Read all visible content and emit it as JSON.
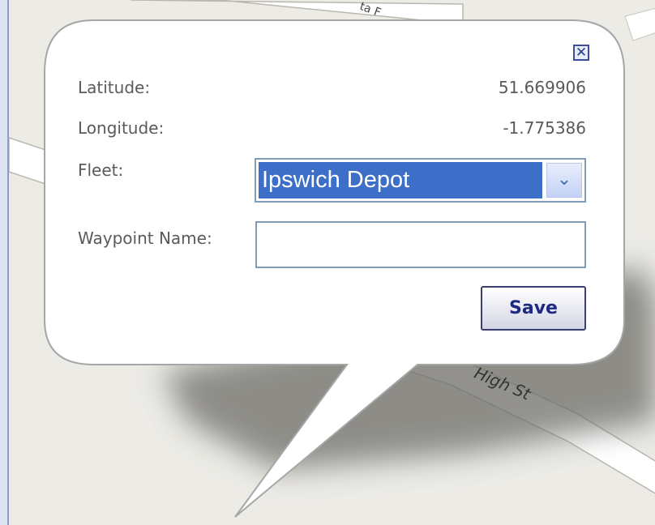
{
  "map": {
    "street_label": "High St",
    "street_label_top": "ta  F"
  },
  "popup": {
    "close_icon": "close-x-icon",
    "latitude_label": "Latitude:",
    "latitude_value": "51.669906",
    "longitude_label": "Longitude:",
    "longitude_value": "-1.775386",
    "fleet_label": "Fleet:",
    "fleet_selected": "Ipswich Depot",
    "waypoint_label": "Waypoint Name:",
    "waypoint_value": "",
    "save_label": "Save"
  },
  "colors": {
    "selection": "#3d6fc9",
    "button_text": "#1e2a82",
    "map_bg": "#ecebe6"
  }
}
